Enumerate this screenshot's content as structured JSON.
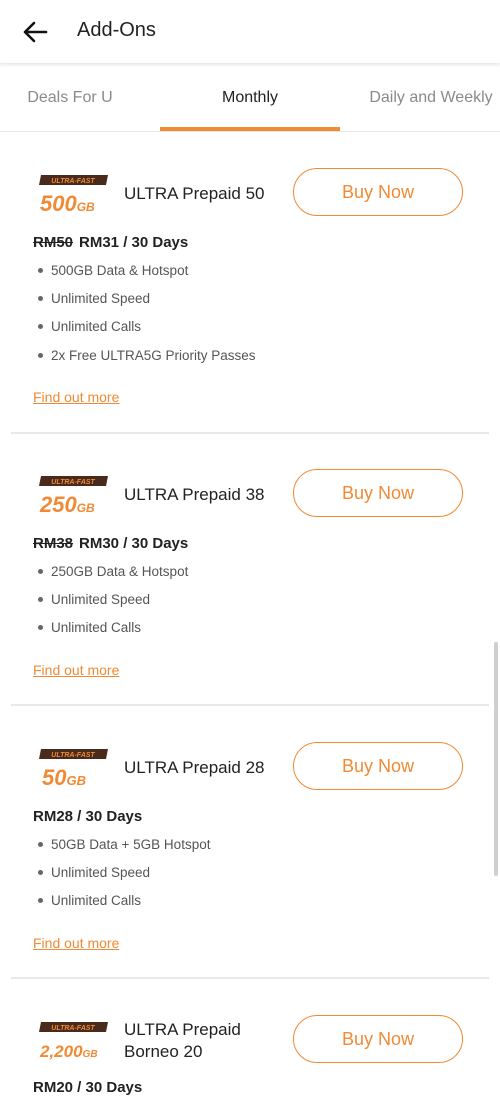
{
  "header": {
    "title": "Add-Ons",
    "back_icon": "arrow-left-icon"
  },
  "tabs": [
    {
      "label": "Deals For U",
      "active": false
    },
    {
      "label": "Monthly",
      "active": true
    },
    {
      "label": "Daily and Weekly",
      "active": false
    }
  ],
  "colors": {
    "accent": "#f08a34",
    "badge_dark": "#4a2a1c"
  },
  "plans": [
    {
      "badge_tag": "ULTRA-FAST",
      "badge_amount": "500",
      "badge_unit": "GB",
      "name": "ULTRA Prepaid 50",
      "buy_label": "Buy Now",
      "old_price": "RM50",
      "price": "RM31 / 30 Days",
      "features": [
        "500GB Data & Hotspot",
        "Unlimited Speed",
        "Unlimited Calls",
        "2x Free ULTRA5G Priority Passes"
      ],
      "more_label": "Find out more"
    },
    {
      "badge_tag": "ULTRA-FAST",
      "badge_amount": "250",
      "badge_unit": "GB",
      "name": "ULTRA Prepaid 38",
      "buy_label": "Buy Now",
      "old_price": "RM38",
      "price": "RM30 / 30 Days",
      "features": [
        "250GB Data & Hotspot",
        "Unlimited Speed",
        "Unlimited Calls"
      ],
      "more_label": "Find out more"
    },
    {
      "badge_tag": "ULTRA-FAST",
      "badge_amount": "50",
      "badge_unit": "GB",
      "name": "ULTRA Prepaid 28",
      "buy_label": "Buy Now",
      "price": "RM28 / 30 Days",
      "features": [
        "50GB Data + 5GB Hotspot",
        "Unlimited Speed",
        "Unlimited Calls"
      ],
      "more_label": "Find out more"
    },
    {
      "badge_tag": "ULTRA-FAST",
      "badge_amount": "2,200",
      "badge_unit": "GB",
      "name_line1": "ULTRA Prepaid",
      "name_line2": "Borneo 20",
      "buy_label": "Buy Now",
      "price": "RM20 / 30 Days"
    }
  ]
}
